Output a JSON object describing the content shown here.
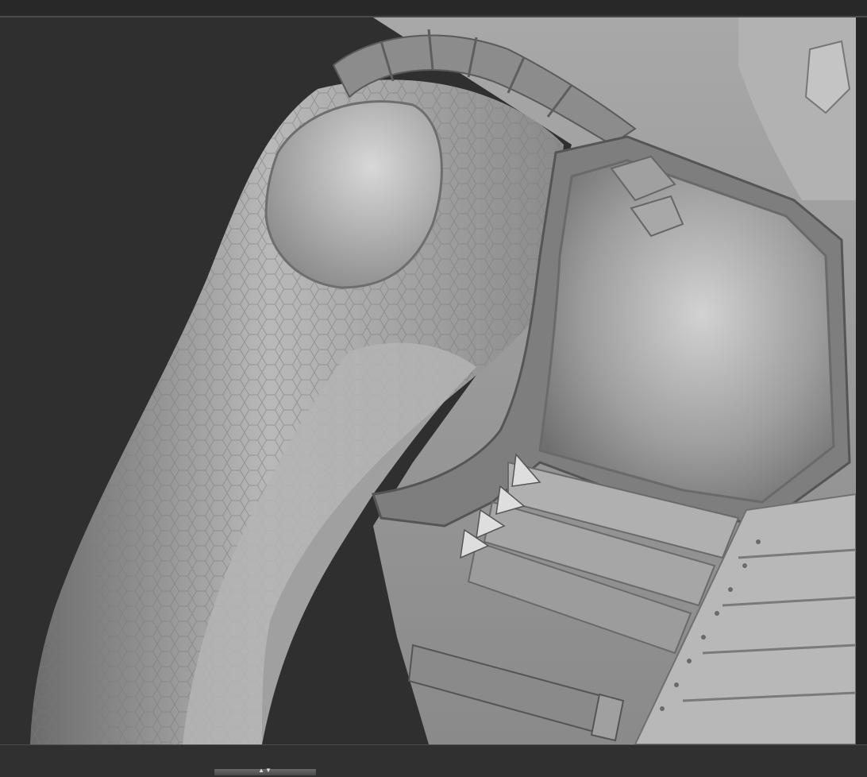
{
  "app": {
    "viewport": {
      "name": "3d-viewport",
      "model_description_hidden": true
    },
    "bottom_shelf": {
      "toggle_glyphs": "▲▼"
    },
    "colors": {
      "background": "#2a2a2a",
      "viewport": "#2f2f2f",
      "model_base": "#9a9a9a"
    }
  }
}
